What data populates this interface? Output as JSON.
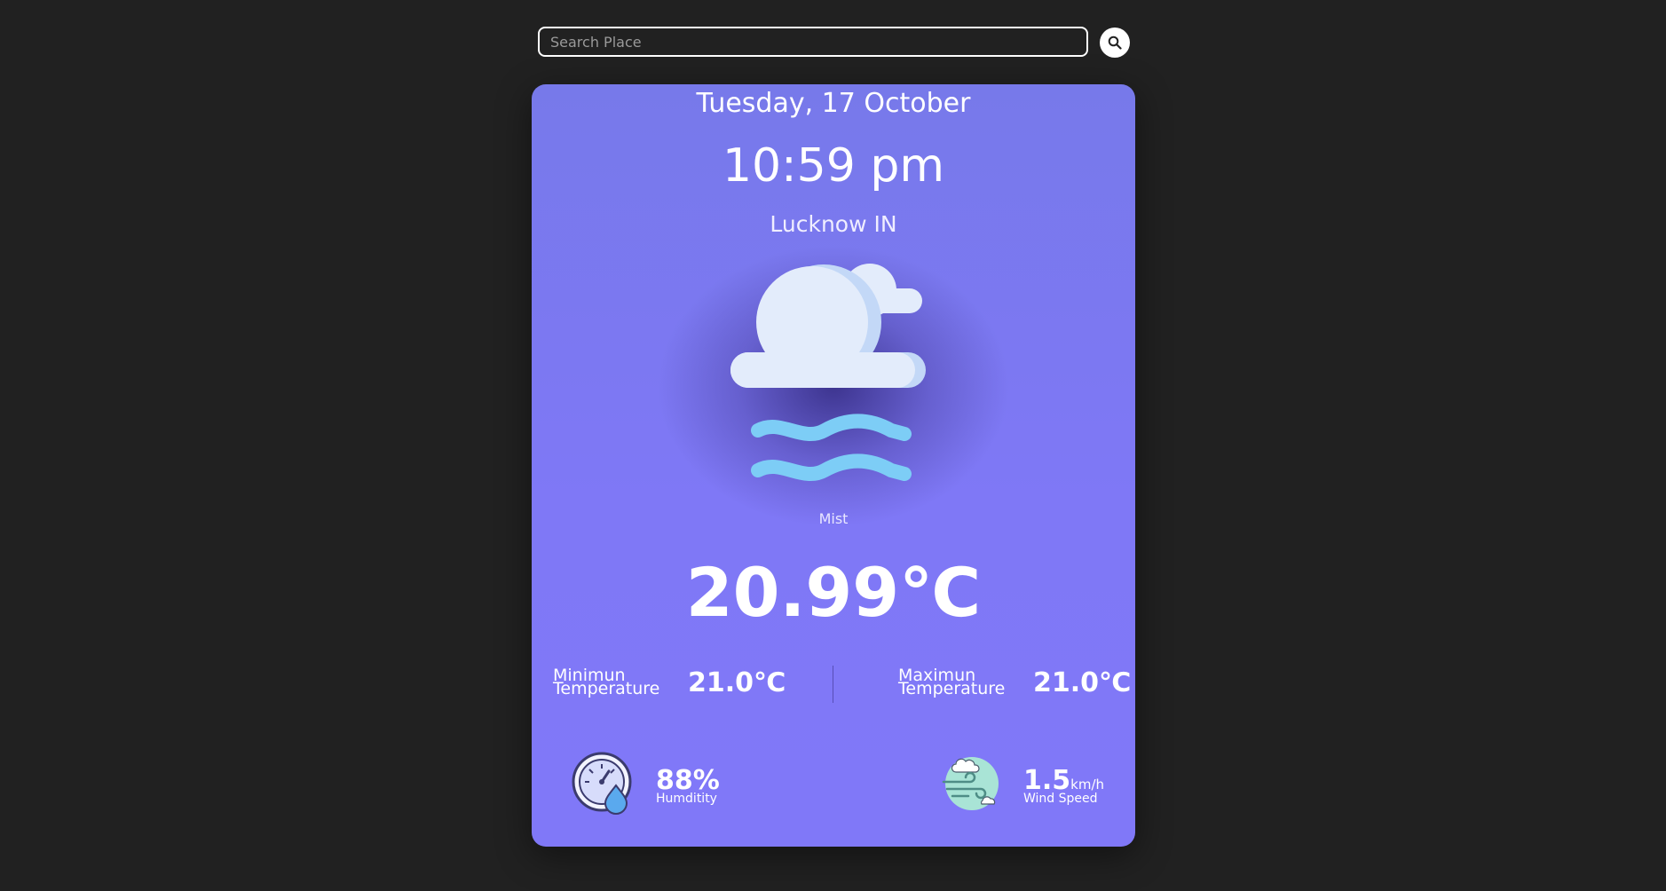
{
  "search": {
    "placeholder": "Search Place",
    "value": "",
    "button_icon": "search-icon"
  },
  "weather": {
    "date": "Tuesday, 17 October",
    "time": "10:59 pm",
    "location": "Lucknow IN",
    "icon": "mist-cloud-icon",
    "condition": "Mist",
    "temperature": "20.99℃",
    "min_label_line1": "Minimun",
    "min_label_line2": "Temperature",
    "min_value": "21.0℃",
    "max_label_line1": "Maximun",
    "max_label_line2": "Temperature",
    "max_value": "21.0℃",
    "humidity_icon": "humidity-gauge-icon",
    "humidity_value": "88%",
    "humidity_label": "Humditity",
    "wind_icon": "wind-icon",
    "wind_value": "1.5",
    "wind_unit": "km/h",
    "wind_label": "Wind Speed"
  },
  "colors": {
    "page_background": "#212121",
    "card_background": "#7f78f6",
    "mist_waves": "#7dcdf6",
    "cloud": "#e3ecfb"
  }
}
